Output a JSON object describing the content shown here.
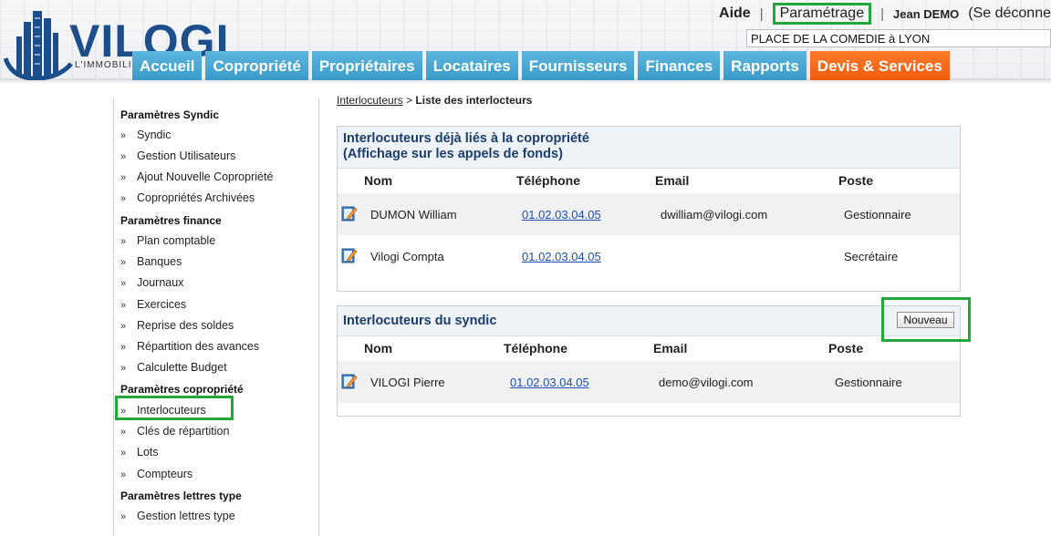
{
  "header": {
    "logo_text": "VILOGI",
    "logo_tagline": "L'IMMOBILIER",
    "links": {
      "help": "Aide",
      "settings": "Paramétrage",
      "user": "Jean DEMO",
      "logout": "(Se déconne",
      "separator": "|"
    },
    "coproperty_selected": "PLACE DE LA COMEDIE à LYON",
    "nav_tabs": [
      {
        "label": "Accueil"
      },
      {
        "label": "Copropriété"
      },
      {
        "label": "Propriétaires"
      },
      {
        "label": "Locataires"
      },
      {
        "label": "Fournisseurs"
      },
      {
        "label": "Finances"
      },
      {
        "label": "Rapports"
      },
      {
        "label": "Devis & Services"
      }
    ],
    "colors": {
      "nav_blue": "#4aa8d6",
      "nav_orange": "#f2661a",
      "highlight_green": "#22a83a",
      "logo_blue": "#1c4e8c"
    }
  },
  "sidebar": {
    "sections": [
      {
        "heading": "Paramètres Syndic",
        "items": [
          "Syndic",
          "Gestion Utilisateurs",
          "Ajout Nouvelle Copropriété",
          "Copropriétés Archivées"
        ]
      },
      {
        "heading": "Paramètres finance",
        "items": [
          "Plan comptable",
          "Banques",
          "Journaux",
          "Exercices",
          "Reprise des soldes",
          "Répartition des avances",
          "Calculette Budget"
        ]
      },
      {
        "heading": "Paramètres copropriété",
        "items": [
          "Interlocuteurs",
          "Clés de répartition",
          "Lots",
          "Compteurs"
        ]
      },
      {
        "heading": "Paramètres lettres type",
        "items": [
          "Gestion lettres type"
        ]
      }
    ],
    "selected_item": "Interlocuteurs",
    "chevron": "»"
  },
  "breadcrumb": {
    "link": "Interlocuteurs",
    "separator": ">",
    "current": "Liste des interlocteurs"
  },
  "panel_linked": {
    "title_line1": "Interlocuteurs déjà liés à la copropriété",
    "title_line2": "(Affichage sur les appels de fonds)",
    "columns": [
      "Nom",
      "Téléphone",
      "Email",
      "Poste"
    ],
    "rows": [
      {
        "name": "DUMON William",
        "phone": "01.02.03.04.05",
        "email": "dwilliam@vilogi.com",
        "role": "Gestionnaire"
      },
      {
        "name": "Vilogi Compta",
        "phone": "01.02.03.04.05",
        "email": "",
        "role": "Secrétaire"
      }
    ]
  },
  "panel_syndic": {
    "title": "Interlocuteurs du syndic",
    "new_button": "Nouveau",
    "columns": [
      "Nom",
      "Téléphone",
      "Email",
      "Poste"
    ],
    "rows": [
      {
        "name": "VILOGI Pierre",
        "phone": "01.02.03.04.05",
        "email": "demo@vilogi.com",
        "role": "Gestionnaire"
      }
    ]
  }
}
